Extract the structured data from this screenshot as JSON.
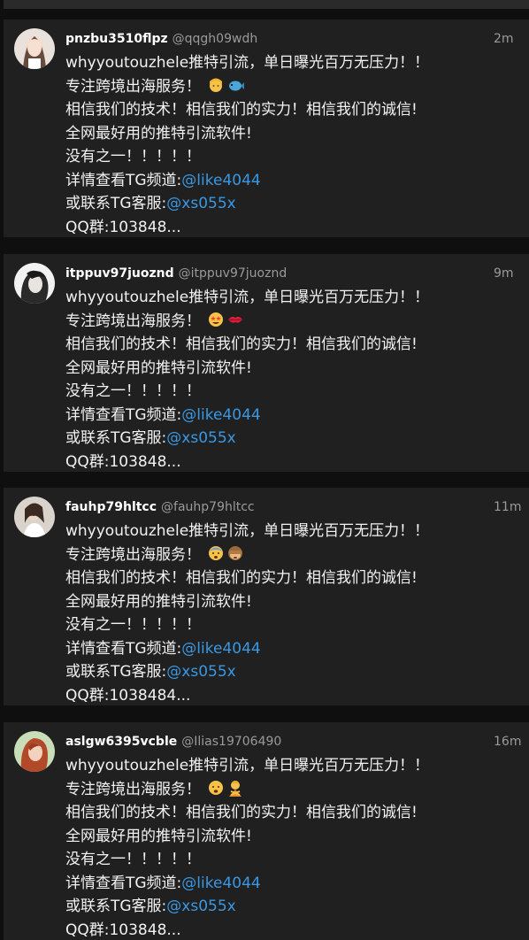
{
  "colors": {
    "background": "#0f0f0f",
    "card": "#202020",
    "text": "#f2f2f2",
    "muted": "#9a9a9a",
    "link": "#3a98e3"
  },
  "posts": [
    {
      "name": "pnzbu3510flpz",
      "handle": "@qqgh09wdh",
      "time": "2m",
      "line1": "whyyoutouzhele推特引流，单日曝光百万无压力！！",
      "line2": "专注跨境出海服务！",
      "emojis": [
        "person-blond-emoji",
        "blowfish-emoji"
      ],
      "line3": "相信我们的技术！相信我们的实力！相信我们的诚信!",
      "line4": "全网最好用的推特引流软件!",
      "line5": "没有之一！！！！！",
      "line6_prefix": "详情查看TG频道:",
      "line6_link": "@like4044",
      "line7_prefix": "或联系TG客服:",
      "line7_link": "@xs055x",
      "line8": "QQ群:103848..."
    },
    {
      "name": "itppuv97juoznd",
      "handle": "@itppuv97juoznd",
      "time": "9m",
      "line1": "whyyoutouzhele推特引流，单日曝光百万无压力！！",
      "line2": "专注跨境出海服务！",
      "emojis": [
        "star-struck-emoji",
        "kiss-mark-emoji"
      ],
      "line3": "相信我们的技术！相信我们的实力！相信我们的诚信!",
      "line4": "全网最好用的推特引流软件!",
      "line5": "没有之一！！！！！",
      "line6_prefix": "详情查看TG频道:",
      "line6_link": "@like4044",
      "line7_prefix": "或联系TG客服:",
      "line7_link": "@xs055x",
      "line8": "QQ群:103848..."
    },
    {
      "name": "fauhp79hltcc",
      "handle": "@fauhp79hltcc",
      "time": "11m",
      "line1": "whyyoutouzhele推特引流，单日曝光百万无压力！！",
      "line2": "专注跨境出海服务！",
      "emojis": [
        "anxious-face-emoji",
        "see-no-evil-monkey-emoji"
      ],
      "line3": "相信我们的技术！相信我们的实力！相信我们的诚信!",
      "line4": "全网最好用的推特引流软件!",
      "line5": "没有之一！！！！！",
      "line6_prefix": "详情查看TG频道:",
      "line6_link": "@like4044",
      "line7_prefix": "或联系TG客服:",
      "line7_link": "@xs055x",
      "line8": "QQ群:1038484..."
    },
    {
      "name": "aslgw6395vcble",
      "handle": "@Ilias19706490",
      "time": "16m",
      "line1": "whyyoutouzhele推特引流，单日曝光百万无压力！！",
      "line2": "专注跨境出海服务！",
      "emojis": [
        "frowning-face-emoji",
        "person-gesturing-no-emoji"
      ],
      "line3": "相信我们的技术！相信我们的实力！相信我们的诚信!",
      "line4": "全网最好用的推特引流软件!",
      "line5": "没有之一！！！！！",
      "line6_prefix": "详情查看TG频道:",
      "line6_link": "@like4044",
      "line7_prefix": "或联系TG客服:",
      "line7_link": "@xs055x",
      "line8": "QQ群:103848..."
    }
  ]
}
